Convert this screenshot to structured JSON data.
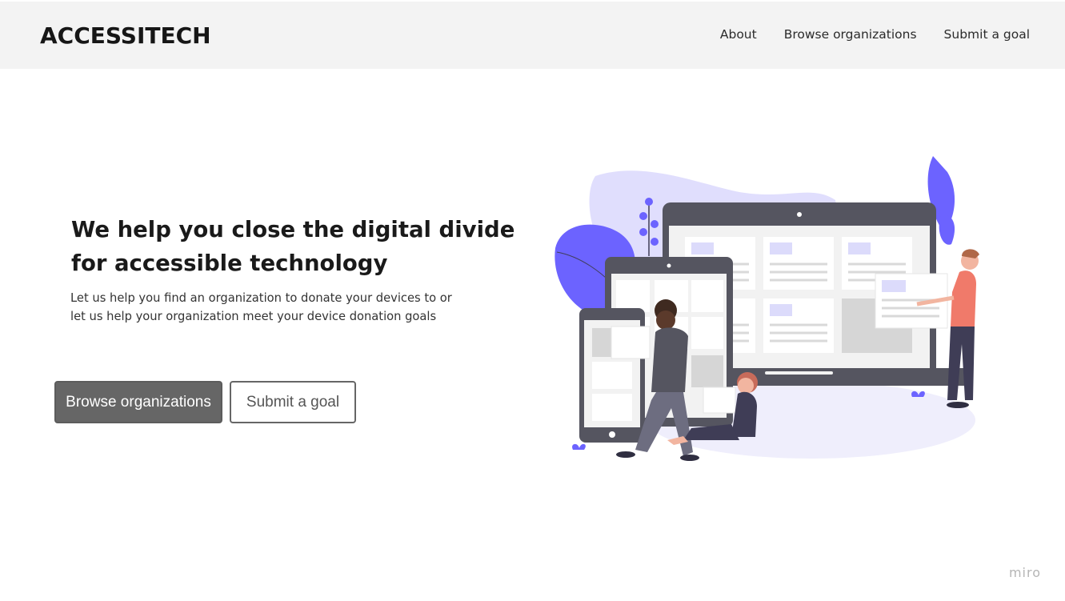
{
  "header": {
    "logo": "ACCESSITECH",
    "nav": [
      {
        "label": "About"
      },
      {
        "label": "Browse organizations"
      },
      {
        "label": "Submit a goal"
      }
    ]
  },
  "hero": {
    "title_line1": "We help you close the digital divide",
    "title_line2": "for accessible technology",
    "subtitle_line1": "Let us help you find an organization to donate your devices to or",
    "subtitle_line2": "let us help your organization meet your device donation goals",
    "primary_button": "Browse organizations",
    "secondary_button": "Submit a goal"
  },
  "watermark": "miro",
  "colors": {
    "header_bg": "#f3f3f3",
    "primary_button_bg": "#666666",
    "accent_purple": "#6c63ff",
    "person_shirt": "#f07a6a"
  }
}
